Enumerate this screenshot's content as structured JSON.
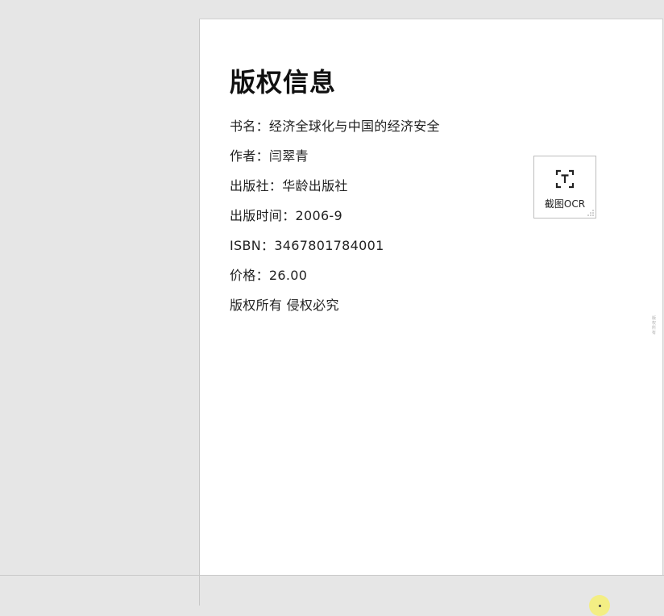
{
  "document": {
    "title": "版权信息",
    "lines": [
      "书名：经济全球化与中国的经济安全",
      "作者：闫翠青",
      "出版社：华龄出版社",
      "出版时间：2006-9",
      "ISBN：3467801784001",
      "价格：26.00",
      "版权所有 侵权必究"
    ]
  },
  "ocr_widget": {
    "label": "截图OCR",
    "icon": "text-scan-icon"
  },
  "side_hint": {
    "text": "版权所有"
  },
  "colors": {
    "page_background": "#ffffff",
    "app_background": "#e6e6e6",
    "cursor_highlight": "#f5ef7a"
  }
}
